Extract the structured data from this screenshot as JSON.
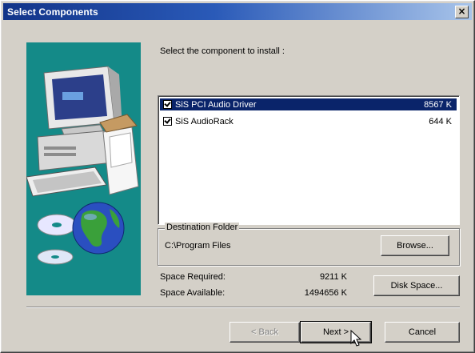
{
  "window": {
    "title": "Select Components",
    "close_glyph": "×"
  },
  "instruction": "Select the component to install :",
  "components": [
    {
      "name": "SiS PCI Audio Driver",
      "size": "8567 K",
      "checked": true,
      "selected": true
    },
    {
      "name": "SiS AudioRack",
      "size": "644 K",
      "checked": true,
      "selected": false
    }
  ],
  "destination": {
    "legend": "Destination Folder",
    "path": "C:\\Program Files",
    "browse_label": "Browse..."
  },
  "space": {
    "required_label": "Space Required:",
    "required_value": "9211 K",
    "available_label": "Space Available:",
    "available_value": "1494656 K",
    "disk_space_label": "Disk Space..."
  },
  "buttons": {
    "back_label": "< Back",
    "next_label": "Next >",
    "cancel_label": "Cancel"
  },
  "colors": {
    "art_bg": "#148a88",
    "selection": "#0a246a",
    "title_start": "#123489"
  }
}
